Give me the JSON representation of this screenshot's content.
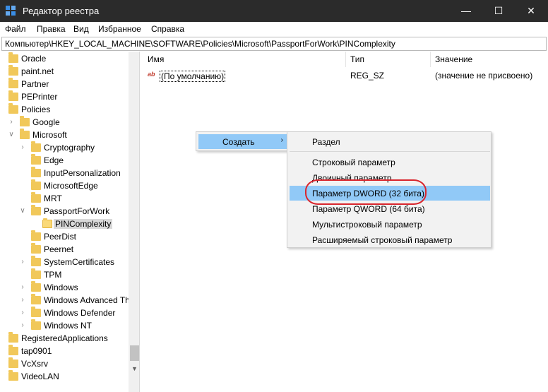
{
  "window": {
    "title": "Редактор реестра",
    "minimize": "—",
    "maximize": "☐",
    "close": "✕"
  },
  "menu": [
    "Файл",
    "Правка",
    "Вид",
    "Избранное",
    "Справка"
  ],
  "address": "Компьютер\\HKEY_LOCAL_MACHINE\\SOFTWARE\\Policies\\Microsoft\\PassportForWork\\PINComplexity",
  "tree": [
    {
      "label": "Oracle"
    },
    {
      "label": "paint.net"
    },
    {
      "label": "Partner"
    },
    {
      "label": "PEPrinter"
    },
    {
      "label": "Policies"
    },
    {
      "label": "Google"
    },
    {
      "label": "Microsoft"
    },
    {
      "label": "Cryptography"
    },
    {
      "label": "Edge"
    },
    {
      "label": "InputPersonalization"
    },
    {
      "label": "MicrosoftEdge"
    },
    {
      "label": "MRT"
    },
    {
      "label": "PassportForWork"
    },
    {
      "label": "PINComplexity"
    },
    {
      "label": "PeerDist"
    },
    {
      "label": "Peernet"
    },
    {
      "label": "SystemCertificates"
    },
    {
      "label": "TPM"
    },
    {
      "label": "Windows"
    },
    {
      "label": "Windows Advanced Th"
    },
    {
      "label": "Windows Defender"
    },
    {
      "label": "Windows NT"
    },
    {
      "label": "RegisteredApplications"
    },
    {
      "label": "tap0901"
    },
    {
      "label": "VcXsrv"
    },
    {
      "label": "VideoLAN"
    }
  ],
  "list": {
    "columns": [
      "Имя",
      "Тип",
      "Значение"
    ],
    "rows": [
      {
        "icon": "ab",
        "name": "(По умолчанию)",
        "type": "REG_SZ",
        "value": "(значение не присвоено)"
      }
    ]
  },
  "context_menu": {
    "label": "Создать",
    "arrow": "›"
  },
  "submenu": [
    "Раздел",
    "Строковый параметр",
    "Двоичный параметр",
    "Параметр DWORD (32 бита)",
    "Параметр QWORD (64 бита)",
    "Мультистроковый параметр",
    "Расширяемый строковый параметр"
  ],
  "highlight_color": "#91c9f7",
  "annotation_color": "#d9262d"
}
